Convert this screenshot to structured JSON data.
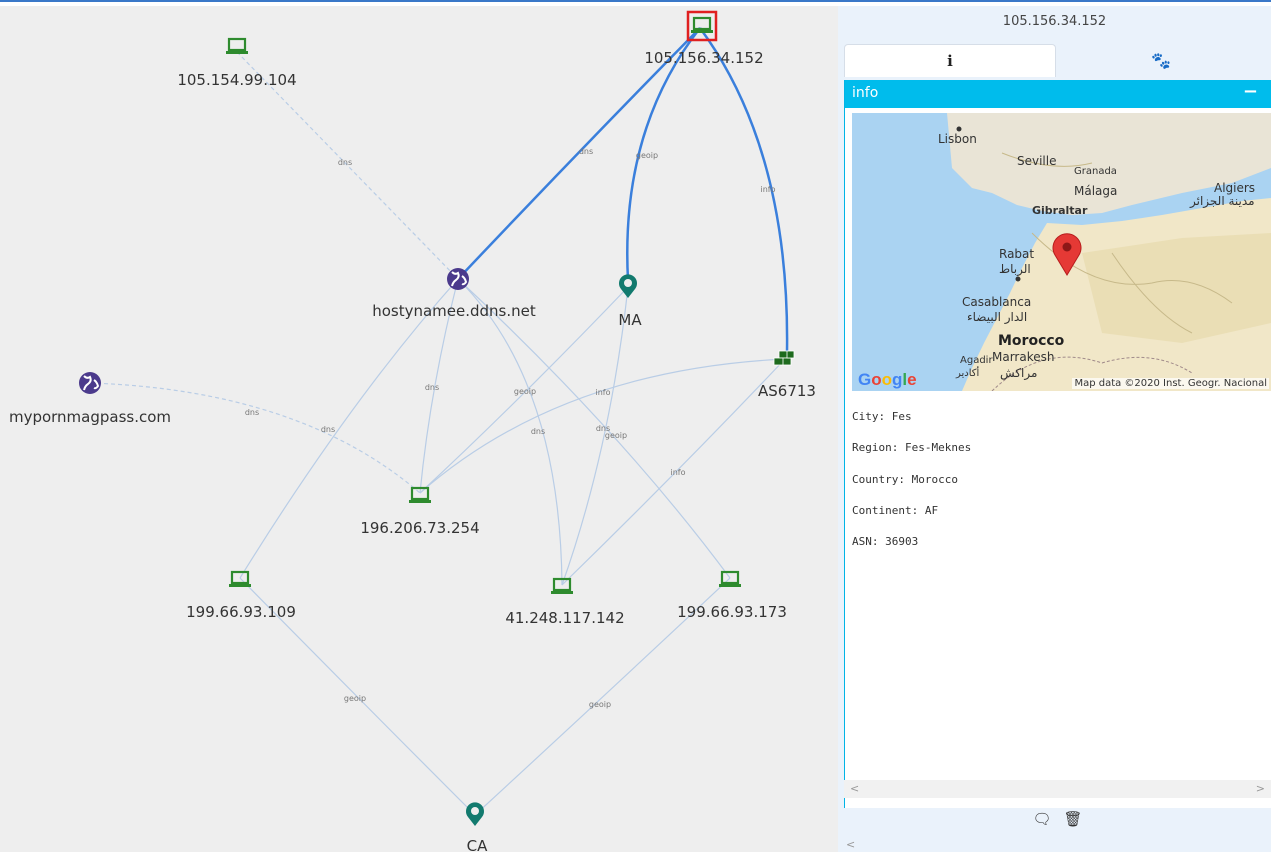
{
  "graph": {
    "nodes": {
      "n1": {
        "label": "105.156.34.152",
        "type": "computer-selected"
      },
      "n2": {
        "label": "105.154.99.104",
        "type": "computer"
      },
      "n3": {
        "label": "hostynamee.ddns.net",
        "type": "globe"
      },
      "n4": {
        "label": "MA",
        "type": "location"
      },
      "n5": {
        "label": "AS6713",
        "type": "asn"
      },
      "n6": {
        "label": "mypornmagpass.com",
        "type": "globe"
      },
      "n7": {
        "label": "196.206.73.254",
        "type": "computer"
      },
      "n8": {
        "label": "199.66.93.109",
        "type": "computer"
      },
      "n9": {
        "label": "41.248.117.142",
        "type": "computer"
      },
      "n10": {
        "label": "199.66.93.173",
        "type": "computer"
      },
      "n11": {
        "label": "CA",
        "type": "location"
      }
    },
    "edge_labels": {
      "dns": "dns",
      "geoip": "geoip",
      "info": "info"
    },
    "colors": {
      "highlight_edge": "#3a7fdc",
      "edge": "#b9cde6",
      "computer": "#2e8b2e",
      "globe": "#4b3a8c",
      "location": "#127a6e",
      "asn": "#1e6b1e",
      "selected_border": "#e02020"
    }
  },
  "panel": {
    "title": "105.156.34.152",
    "tabs": [
      {
        "icon": "info-icon",
        "glyph": "i"
      },
      {
        "icon": "paw-icon",
        "glyph": "🐾"
      }
    ],
    "section_title": "info",
    "collapse_glyph": "−",
    "map": {
      "places": {
        "lisbon": "Lisbon",
        "seville": "Seville",
        "granada": "Granada",
        "malaga": "Málaga",
        "algiers": "Algiers",
        "algiers_ar": "مدينة الجزائر",
        "gibraltar": "Gibraltar",
        "rabat": "Rabat",
        "rabat_ar": "الرباط",
        "casablanca": "Casablanca",
        "casablanca_ar": "الدار البيضاء",
        "morocco": "Morocco",
        "agadir": "Agadir",
        "agadir_ar": "أكادير",
        "marrakesh": "Marrakesh",
        "marrakesh_ar": "مراكش"
      },
      "logo": "Google",
      "attribution": "Map data ©2020 Inst. Geogr. Nacional"
    },
    "facts": {
      "city": "City: Fes",
      "region": "Region: Fes-Meknes",
      "country": "Country: Morocco",
      "continent": "Continent: AF",
      "asn": "ASN: 36903"
    },
    "scroll_left": "<",
    "scroll_right": ">",
    "footer_icons": {
      "comment": "🗨",
      "trash": "🗑"
    }
  }
}
